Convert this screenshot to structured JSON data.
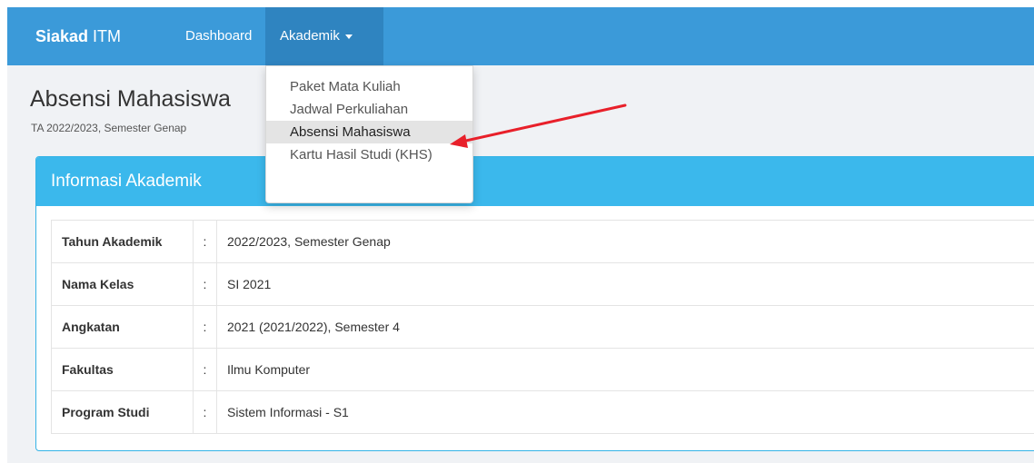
{
  "navbar": {
    "brand_bold": "Siakad",
    "brand_rest": " ITM",
    "dashboard": "Dashboard",
    "akademik": "Akademik"
  },
  "page": {
    "title": "Absensi Mahasiswa",
    "subtitle": "TA 2022/2023, Semester Genap"
  },
  "panel": {
    "heading": "Informasi Akademik",
    "rows": [
      {
        "label": "Tahun Akademik",
        "colon": ":",
        "value": "2022/2023, Semester Genap"
      },
      {
        "label": "Nama Kelas",
        "colon": ":",
        "value": "SI 2021"
      },
      {
        "label": "Angkatan",
        "colon": ":",
        "value": "2021 (2021/2022), Semester 4"
      },
      {
        "label": "Fakultas",
        "colon": ":",
        "value": "Ilmu Komputer"
      },
      {
        "label": "Program Studi",
        "colon": ":",
        "value": "Sistem Informasi - S1"
      }
    ]
  },
  "dropdown": {
    "items": [
      {
        "label": "Paket Mata Kuliah"
      },
      {
        "label": "Jadwal Perkuliahan"
      },
      {
        "label": "Absensi Mahasiswa",
        "active": true
      },
      {
        "label": "Kartu Hasil Studi (KHS)"
      }
    ]
  },
  "colors": {
    "navbar": "#3b9ad9",
    "navbar_active": "#2f84c0",
    "panel_heading": "#3bb8ec",
    "annotation_arrow": "#e8202a"
  }
}
